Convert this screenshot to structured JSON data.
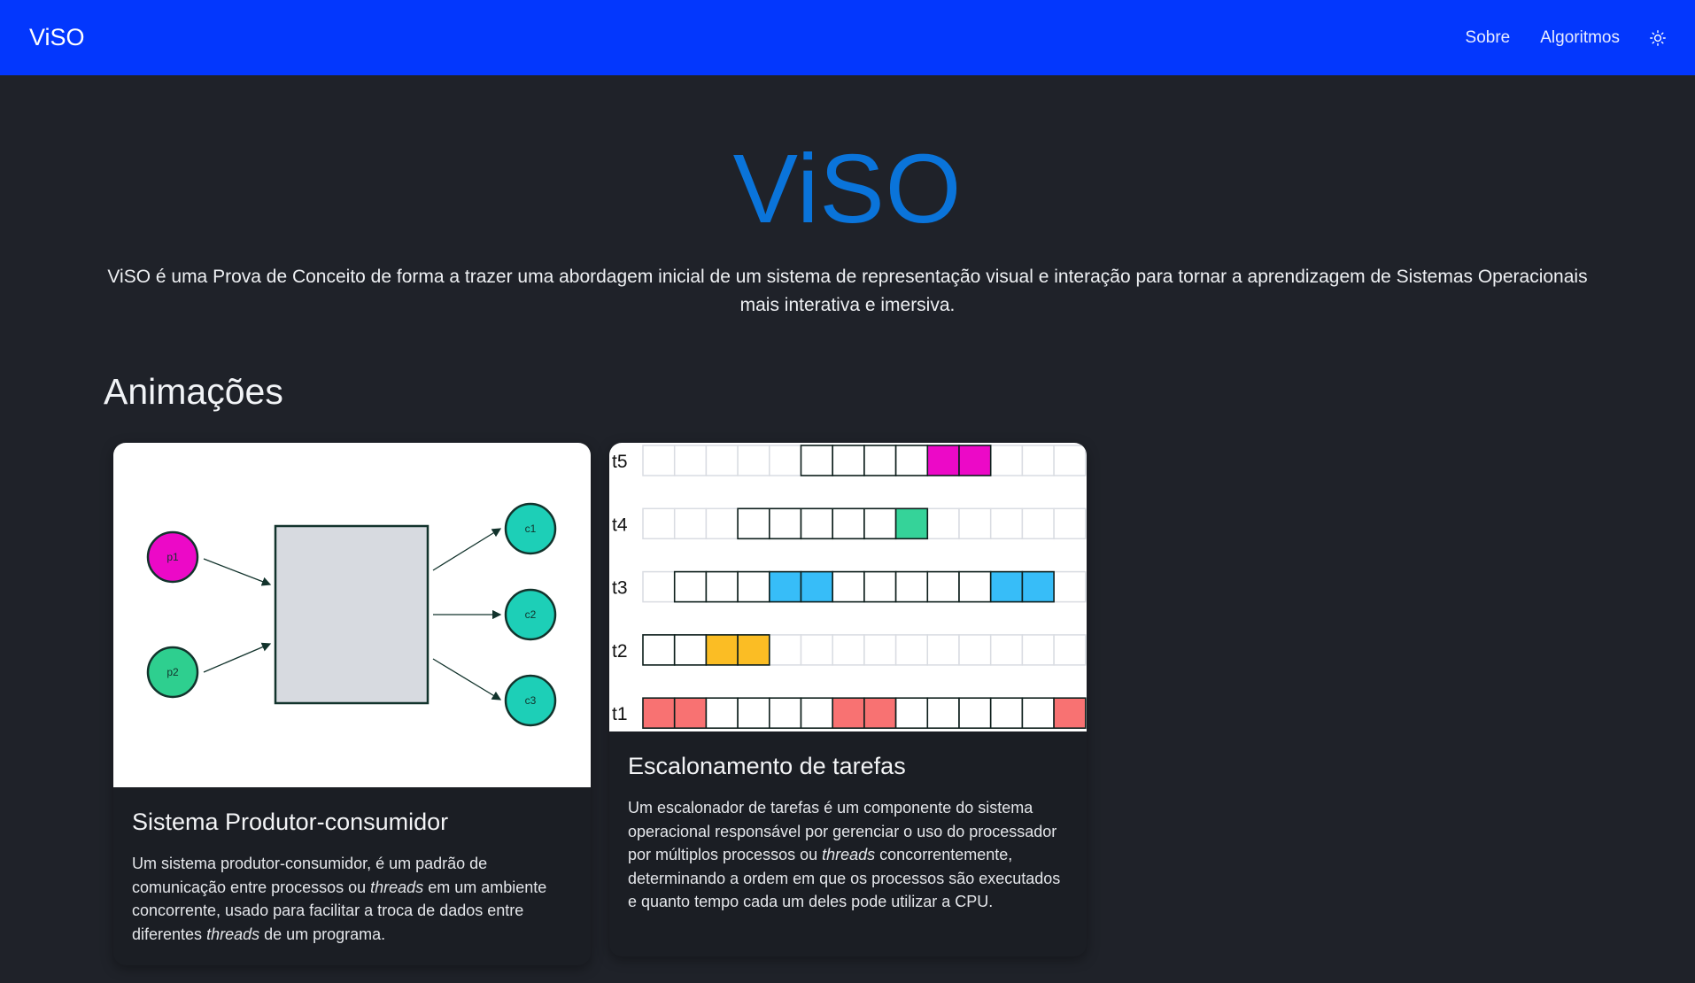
{
  "nav": {
    "brand": "ViSO",
    "links": [
      "Sobre",
      "Algoritmos"
    ],
    "theme_icon": "sun-icon"
  },
  "hero": {
    "title": "ViSO",
    "description": "ViSO é uma Prova de Conceito de forma a trazer uma abordagem inicial de um sistema de representação visual e interação para tornar a aprendizagem de Sistemas Operacionais mais interativa e imersiva."
  },
  "section": {
    "title": "Animações"
  },
  "cards": [
    {
      "title": "Sistema Produtor-consumidor",
      "text_parts": [
        "Um sistema produtor-consumidor, é um padrão de comunicação entre processos ou ",
        "threads",
        " em um ambiente concorrente, usado para facilitar a troca de dados entre diferentes ",
        "threads",
        " de um programa."
      ],
      "diagram": {
        "producers": [
          "p1",
          "p2"
        ],
        "consumers": [
          "c1",
          "c2",
          "c3"
        ],
        "colors": {
          "p1": "#ec09c7",
          "p2": "#2ecf8f",
          "consumer": "#1dcfb7",
          "buffer": "#d7dae0",
          "stroke": "#12332c"
        }
      }
    },
    {
      "title": "Escalonamento de tarefas",
      "text_parts": [
        "Um escalonador de tarefas é um componente do sistema operacional responsável por gerenciar o uso do processador por múltiplos processos ou ",
        "threads",
        " concorrentemente, determinando a ordem em que os processos são executados e quanto tempo cada um deles pode utilizar a CPU."
      ],
      "schedule": {
        "columns": 14,
        "rows": [
          {
            "label": "t5",
            "start": 5,
            "end": 11,
            "color": "#ec09c7",
            "running": [
              9,
              10
            ]
          },
          {
            "label": "t4",
            "start": 3,
            "end": 9,
            "color": "#35d399",
            "running": [
              8
            ]
          },
          {
            "label": "t3",
            "start": 1,
            "end": 13,
            "color": "#37bdf8",
            "running": [
              4,
              5,
              11,
              12
            ]
          },
          {
            "label": "t2",
            "start": 0,
            "end": 4,
            "color": "#fbbd24",
            "running": [
              2,
              3
            ]
          },
          {
            "label": "t1",
            "start": 0,
            "end": 14,
            "color": "#f87272",
            "running": [
              0,
              1,
              6,
              7,
              13
            ]
          }
        ]
      }
    }
  ]
}
